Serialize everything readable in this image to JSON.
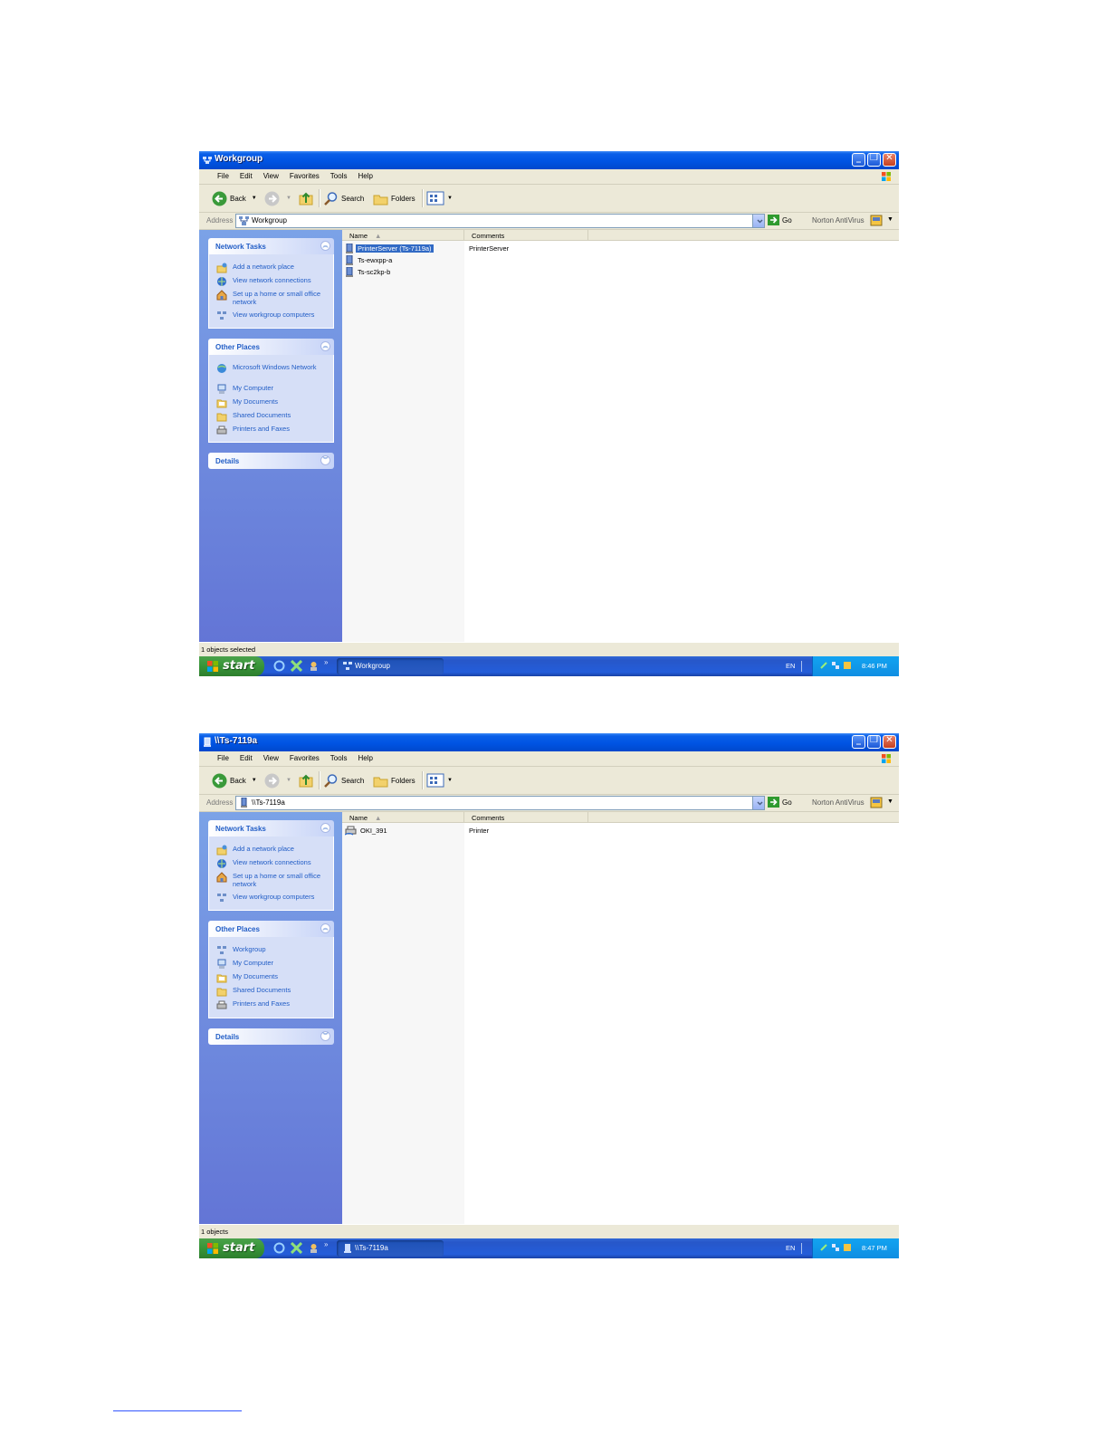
{
  "windows": [
    {
      "title": "Workgroup",
      "menu": [
        "File",
        "Edit",
        "View",
        "Favorites",
        "Tools",
        "Help"
      ],
      "toolbar": {
        "back": "Back",
        "search": "Search",
        "folders": "Folders"
      },
      "address": {
        "label": "Address",
        "value": "Workgroup",
        "go": "Go",
        "norton": "Norton AntiVirus"
      },
      "network_tasks": {
        "title": "Network Tasks",
        "items": [
          "Add a network place",
          "View network connections",
          "Set up a home or small office network",
          "View workgroup computers"
        ]
      },
      "other_places": {
        "title": "Other Places",
        "items": [
          "Microsoft Windows Network",
          "My Computer",
          "My Documents",
          "Shared Documents",
          "Printers and Faxes"
        ]
      },
      "details": {
        "title": "Details"
      },
      "columns": {
        "name": "Name",
        "comments": "Comments"
      },
      "rows": [
        {
          "name": "PrinterServer (Ts-7119a)",
          "comment": "PrinterServer",
          "selected": true
        },
        {
          "name": "Ts-ewxpp-a",
          "comment": "",
          "selected": false
        },
        {
          "name": "Ts-sc2kp-b",
          "comment": "",
          "selected": false
        }
      ],
      "status": "1 objects selected",
      "taskbar": {
        "start": "start",
        "task": "Workgroup",
        "lang": "EN",
        "clock": "8:46 PM"
      }
    },
    {
      "title": "\\\\Ts-7119a",
      "menu": [
        "File",
        "Edit",
        "View",
        "Favorites",
        "Tools",
        "Help"
      ],
      "toolbar": {
        "back": "Back",
        "search": "Search",
        "folders": "Folders"
      },
      "address": {
        "label": "Address",
        "value": "\\\\Ts-7119a",
        "go": "Go",
        "norton": "Norton AntiVirus"
      },
      "network_tasks": {
        "title": "Network Tasks",
        "items": [
          "Add a network place",
          "View network connections",
          "Set up a home or small office network",
          "View workgroup computers"
        ]
      },
      "other_places": {
        "title": "Other Places",
        "items": [
          "Workgroup",
          "My Computer",
          "My Documents",
          "Shared Documents",
          "Printers and Faxes"
        ]
      },
      "details": {
        "title": "Details"
      },
      "columns": {
        "name": "Name",
        "comments": "Comments"
      },
      "rows": [
        {
          "name": "OKI_391",
          "comment": "Printer",
          "selected": false
        }
      ],
      "status": "1 objects",
      "taskbar": {
        "start": "start",
        "task": "\\\\Ts-7119a",
        "lang": "EN",
        "clock": "8:47 PM"
      }
    }
  ]
}
